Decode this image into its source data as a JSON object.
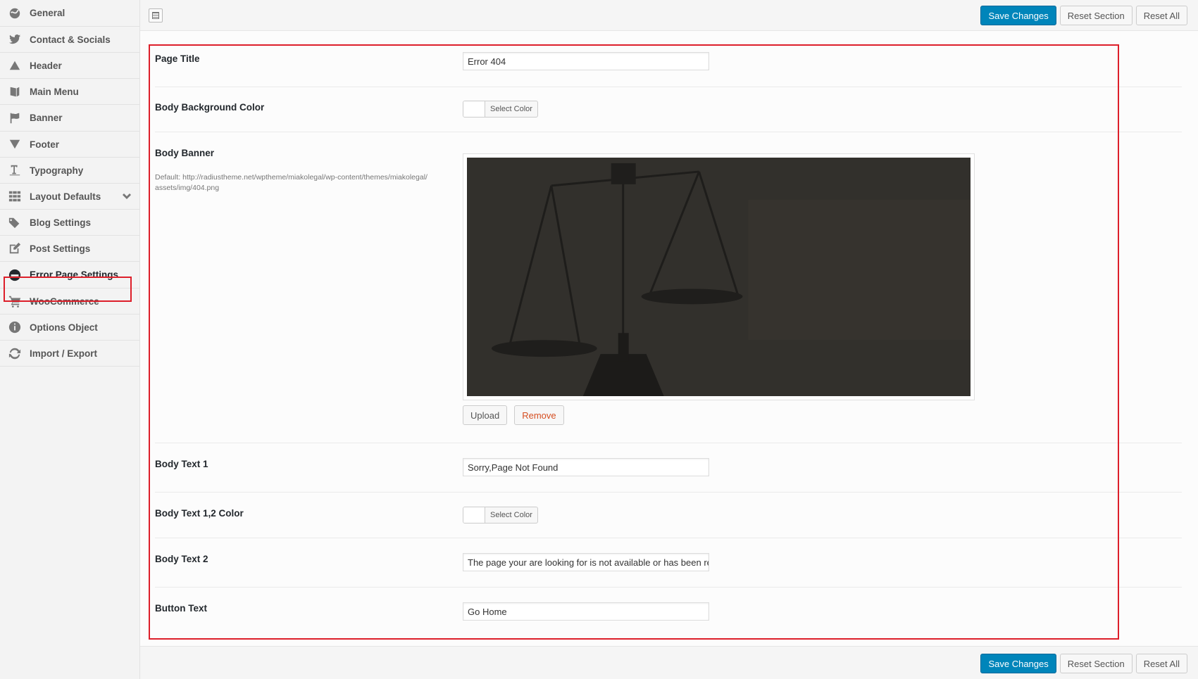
{
  "sidebar": {
    "items": [
      {
        "label": "General",
        "icon": "globe-icon"
      },
      {
        "label": "Contact & Socials",
        "icon": "twitter-icon"
      },
      {
        "label": "Header",
        "icon": "triangle-up-icon"
      },
      {
        "label": "Main Menu",
        "icon": "book-icon"
      },
      {
        "label": "Banner",
        "icon": "flag-icon"
      },
      {
        "label": "Footer",
        "icon": "triangle-down-icon"
      },
      {
        "label": "Typography",
        "icon": "text-icon"
      },
      {
        "label": "Layout Defaults",
        "icon": "grid-icon"
      },
      {
        "label": "Blog Settings",
        "icon": "tags-icon"
      },
      {
        "label": "Post Settings",
        "icon": "edit-icon"
      },
      {
        "label": "Error Page Settings",
        "icon": "minus-circle-icon"
      },
      {
        "label": "WooCommerce",
        "icon": "cart-icon"
      },
      {
        "label": "Options Object",
        "icon": "info-icon"
      },
      {
        "label": "Import / Export",
        "icon": "refresh-icon"
      }
    ],
    "active": "Error Page Settings"
  },
  "toolbar": {
    "save_label": "Save Changes",
    "reset_section_label": "Reset Section",
    "reset_all_label": "Reset All"
  },
  "fields": {
    "page_title": {
      "label": "Page Title",
      "value": "Error 404"
    },
    "body_bg_color": {
      "label": "Body Background Color",
      "button": "Select Color"
    },
    "body_banner": {
      "label": "Body Banner",
      "desc": "Default: http://radiustheme.net/wptheme/miakolegal/wp-content/themes/miakolegal/assets/img/404.png",
      "upload_label": "Upload",
      "remove_label": "Remove"
    },
    "body_text_1": {
      "label": "Body Text 1",
      "value": "Sorry,Page Not Found"
    },
    "body_text_color": {
      "label": "Body Text 1,2 Color",
      "button": "Select Color"
    },
    "body_text_2": {
      "label": "Body Text 2",
      "value": "The page your are looking for is not available or has been removed"
    },
    "button_text": {
      "label": "Button Text",
      "value": "Go Home"
    }
  },
  "colors": {
    "primary": "#0085ba",
    "highlight": "#dd1f2a",
    "remove": "#d54e21"
  }
}
